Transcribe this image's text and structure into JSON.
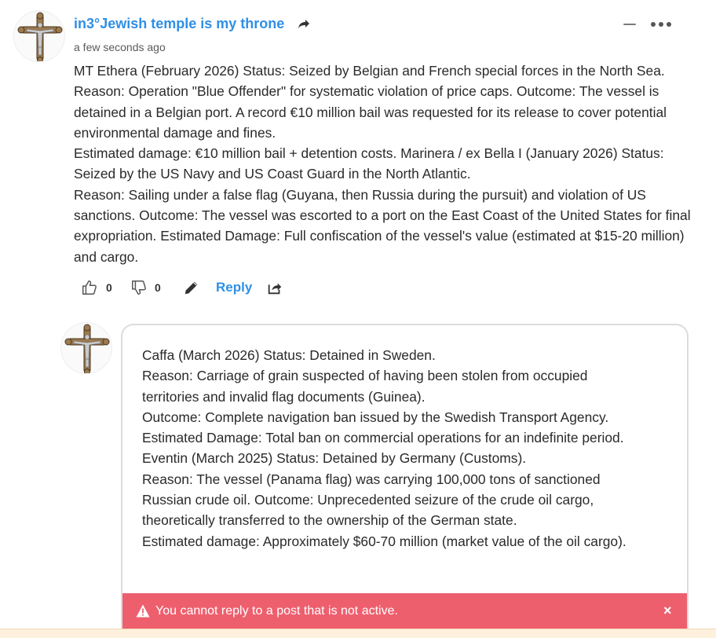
{
  "comment": {
    "author": "in3°Jewish temple is my throne",
    "timestamp": "a few seconds ago",
    "paragraphs": [
      "MT Ethera (February 2026) Status: Seized by Belgian and French special forces in the North Sea. Reason: Operation \"Blue Offender\" for systematic violation of price caps. Outcome: The vessel is detained in a Belgian port. A record €10 million bail was requested for its release to cover potential environmental damage and fines.",
      "Estimated damage: €10 million bail + detention costs. Marinera / ex Bella I (January 2026) Status: Seized by the US Navy and US Coast Guard in the North Atlantic.",
      "Reason: Sailing under a false flag (Guyana, then Russia during the pursuit) and violation of US sanctions. Outcome: The vessel was escorted to a port on the East Coast of the United States for final expropriation. Estimated Damage: Full confiscation of the vessel's value (estimated at $15-20 million) and cargo."
    ],
    "upvotes": "0",
    "downvotes": "0",
    "reply_label": "Reply"
  },
  "reply_draft": {
    "lines": [
      "Caffa (March 2026)  Status: Detained in Sweden.",
      "Reason: Carriage of grain suspected of having been stolen from occupied",
      "territories and invalid flag documents (Guinea).",
      "Outcome: Complete navigation ban issued by the Swedish Transport Agency.",
      "Estimated Damage: Total ban on commercial operations for an indefinite period.",
      "Eventin (March 2025) Status: Detained by Germany (Customs).",
      "Reason: The vessel (Panama flag) was carrying 100,000 tons of sanctioned",
      "Russian crude oil.  Outcome: Unprecedented seizure of the crude oil cargo,",
      "theoretically transferred to the ownership of the German state.",
      "Estimated damage: Approximately $60-70 million (market value of the oil cargo)."
    ]
  },
  "alert": {
    "message": "You cannot reply to a post that is not active.",
    "close_symbol": "×"
  },
  "icons": {
    "avatar": "crucifix-avatar-icon",
    "share": "share-arrow-icon",
    "minimize": "minimize-icon",
    "more": "more-options-icon",
    "upvote": "thumbs-up-icon",
    "downvote": "thumbs-down-icon",
    "edit": "pencil-icon",
    "share_post": "share-box-icon",
    "warning": "warning-triangle-icon"
  },
  "colors": {
    "accent": "#2f8fe6",
    "alert_bg": "#ee5f6e",
    "footer_bg": "#fdf0dc"
  }
}
